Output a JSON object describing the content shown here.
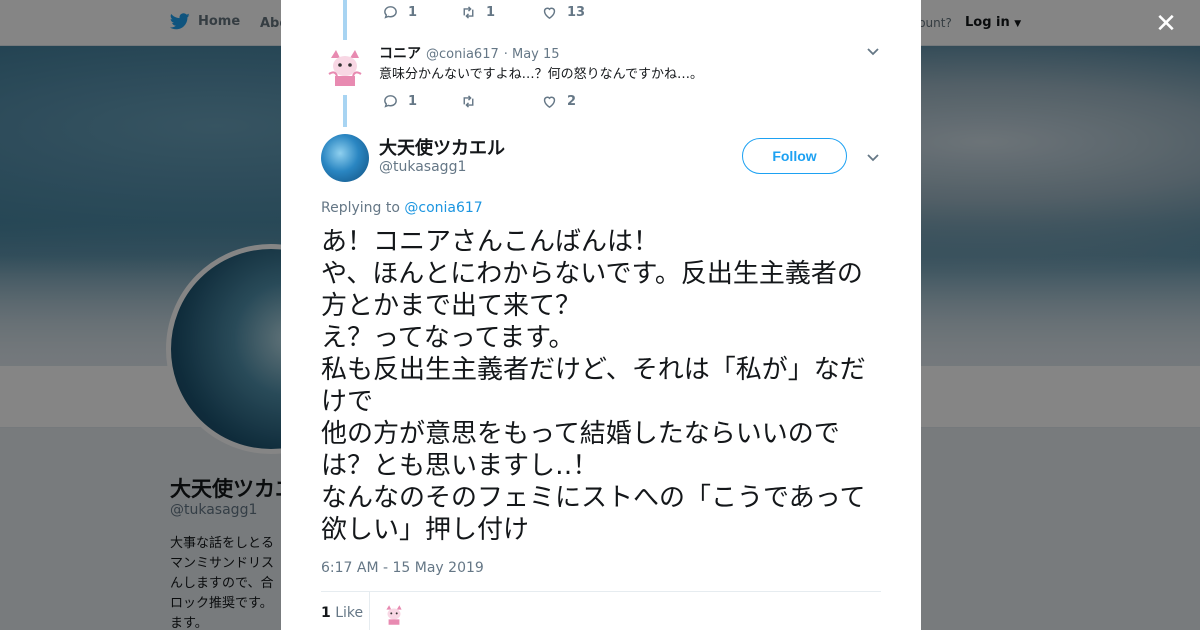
{
  "topbar": {
    "home_label": "Home",
    "about_label": "Abo",
    "account_prompt": "ccount?",
    "login_label": "Log in"
  },
  "profile": {
    "name": "大天使ツカエ",
    "handle": "@tukasagg1",
    "bio_lines": [
      "大事な話をしとる",
      "マンミサンドリス",
      "んしますので、合",
      "ロック推奨です。",
      "ます。"
    ]
  },
  "modal": {
    "prev_actions": {
      "replies": "1",
      "retweets": "1",
      "likes": "13"
    },
    "reply": {
      "name": "コニア",
      "handle": "@conia617",
      "date": "· May 15",
      "text": "意味分かんないですよね…？何の怒りなんですかね…。",
      "actions": {
        "replies": "1",
        "retweets": "",
        "likes": "2"
      }
    },
    "tweet": {
      "name": "大天使ツカエル",
      "handle": "@tukasagg1",
      "follow_label": "Follow",
      "replying_prefix": "Replying to ",
      "replying_to": "@conia617",
      "text": "あ！コニアさんこんばんは！\nや、ほんとにわからないです。反出生主義者の方とかまで出て来て？\nえ？ってなってます。\n私も反出生主義者だけど、それは「私が」なだけで\n他の方が意思をもって結婚したならいいのでは？とも思いますし‥！\nなんなのそのフェミにストへの「こうであって欲しい」押し付け",
      "timestamp": "6:17 AM - 15 May 2019",
      "like_count": "1",
      "like_label": "Like"
    }
  },
  "colors": {
    "accent": "#1da1f2",
    "thread_line": "#a8d4f2",
    "muted": "#657786"
  }
}
